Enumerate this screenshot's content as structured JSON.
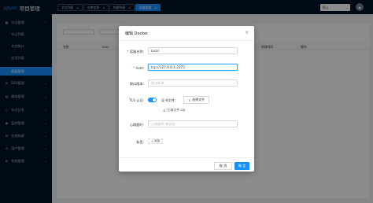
{
  "app": {
    "logo": "Jipom",
    "title": "项目管理"
  },
  "sidebar": {
    "items": [
      {
        "icon": "▦",
        "label": "节点管理",
        "caret": "⌃"
      },
      {
        "label": "节点列表"
      },
      {
        "label": "节点统计"
      },
      {
        "label": "应用列表"
      },
      {
        "label": "容器管理"
      },
      {
        "icon": "◎",
        "label": "SSH管理",
        "caret": "⌄"
      },
      {
        "icon": "▤",
        "label": "脚本管理",
        "caret": "⌄"
      },
      {
        "icon": "◇",
        "label": "节点分发",
        "caret": "⌄"
      },
      {
        "icon": "◉",
        "label": "监控管理",
        "caret": "⌄"
      },
      {
        "icon": "⊟",
        "label": "在线构建",
        "caret": "⌄"
      },
      {
        "icon": "♙",
        "label": "用户管理",
        "caret": "⌄"
      },
      {
        "icon": "⚙",
        "label": "系统管理",
        "caret": "⌄"
      }
    ]
  },
  "topbar": {
    "tabs": [
      {
        "label": "节点列表",
        "close": "×"
      },
      {
        "label": "仓库信息",
        "close": "×"
      },
      {
        "label": "构建列表",
        "close": "×"
      },
      {
        "label": "容器管理",
        "close": "×"
      }
    ],
    "lang_select": "默认",
    "lang_chevron": "⌄"
  },
  "table": {
    "headers": [
      "名称",
      "host",
      "",
      "",
      "",
      "修改时间",
      "操作"
    ]
  },
  "modal": {
    "title": "编辑 Docker",
    "close": "×",
    "fields": {
      "name": {
        "label": "容器名称:",
        "value": "local"
      },
      "host": {
        "label": "host:",
        "value": "tcp://127.0.0.1:2375"
      },
      "api_version": {
        "label": "接口版本:",
        "placeholder": "接口版本"
      },
      "tls": {
        "label": "TLS 认证:",
        "enabled": true,
        "cert_label": "证书文件:",
        "upload_label": "选择文件",
        "file_name": "压缩文件.zip"
      },
      "heartbeat": {
        "label": "心跳超时:",
        "placeholder": "心跳超时 单位秒"
      },
      "tags": {
        "label": "标签:",
        "add_label": "添加"
      }
    },
    "buttons": {
      "cancel": "取 消",
      "ok": "确 定"
    }
  }
}
